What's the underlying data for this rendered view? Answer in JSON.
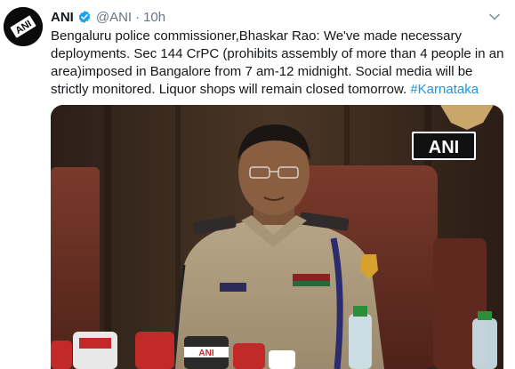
{
  "tweet": {
    "author": {
      "name": "ANI",
      "handle": "@ANI",
      "verified": true,
      "avatar_text": "ANI"
    },
    "separator": "·",
    "timestamp": "10h",
    "text": "Bengaluru police commissioner,Bhaskar Rao: We've made necessary deployments. Sec 144 CrPC (prohibits assembly of more than 4 people in an area)imposed in Bangalore from 7 am-12 midnight. Social media will be strictly monitored. Liquor shops will remain closed tomorrow. ",
    "hashtag": "#Karnataka",
    "media": {
      "watermark": "ANI",
      "mic_label": "ANI"
    }
  },
  "colors": {
    "text": "#14171a",
    "secondary": "#657786",
    "link": "#1b95e0",
    "verified": "#1da1f2"
  },
  "icons": {
    "verified": "verified-badge-icon",
    "menu": "chevron-down-icon"
  }
}
